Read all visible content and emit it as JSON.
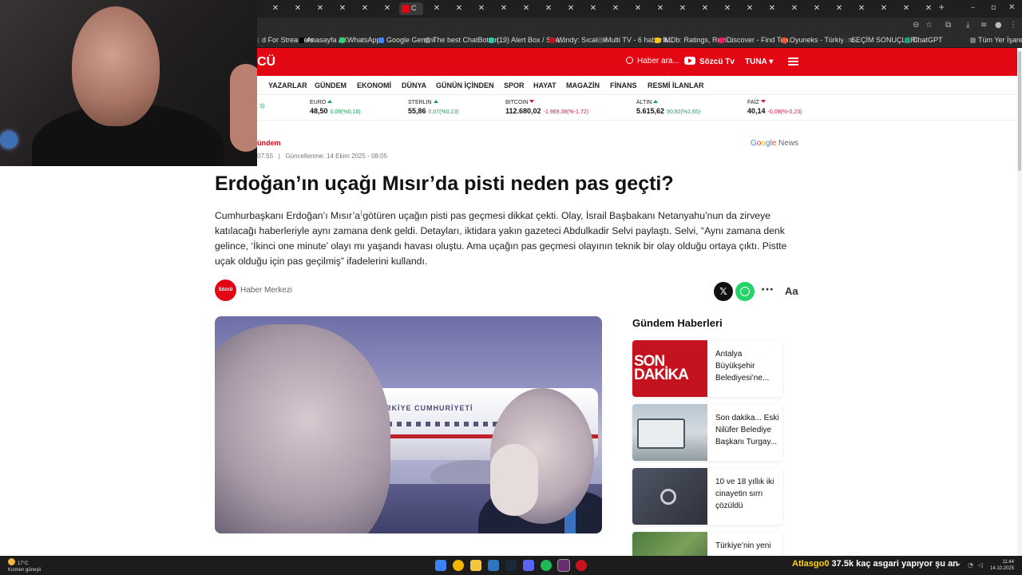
{
  "browser": {
    "active_tab_label": "C",
    "bookmarks": [
      {
        "label": "d For Streamers",
        "color": "#444444"
      },
      {
        "label": "Anasayfa / X",
        "color": "#000000"
      },
      {
        "label": "WhatsApp",
        "color": "#25d366"
      },
      {
        "label": "Google Gemini",
        "color": "#4285f4"
      },
      {
        "label": "The best ChatBot an...",
        "color": "#888888"
      },
      {
        "label": "(19) Alert Box / Stre...",
        "color": "#31c3a2"
      },
      {
        "label": "Windy: Sıcaklık",
        "color": "#c4121f"
      },
      {
        "label": "Multi TV - 6 haber k...",
        "color": "#555555"
      },
      {
        "label": "IMDb: Ratings, Revi...",
        "color": "#f5c518"
      },
      {
        "label": "Discover - Find Top...",
        "color": "#e91e63"
      },
      {
        "label": "Oyuneks - Türkiyeni...",
        "color": "#ff5722"
      },
      {
        "label": "SEÇİM SONUÇLARI...",
        "color": "#333333"
      },
      {
        "label": "ChatGPT",
        "color": "#10a37f"
      },
      {
        "label": "Tüm Yer İşaretleri",
        "color": "#777777"
      }
    ]
  },
  "site": {
    "logo_text": "CÜ",
    "search_label": "Haber ara...",
    "tv_label": "Sözcü Tv",
    "user_label": "TUNA",
    "nav": [
      "YAZARLAR",
      "GÜNDEM",
      "EKONOMİ",
      "DÜNYA",
      "GÜNÜN İÇİNDEN",
      "SPOR",
      "HAYAT",
      "MAGAZİN",
      "FİNANS",
      "RESMİ İLANLAR"
    ],
    "markets": [
      {
        "name": "",
        "value": "",
        "change": "3)",
        "direction": "none"
      },
      {
        "name": "EURO",
        "value": "48,50",
        "change": "0,09(%0,18)",
        "direction": "up"
      },
      {
        "name": "STERLIN",
        "value": "55,86",
        "change": "0,07(%0,13)",
        "direction": "up"
      },
      {
        "name": "BITCOIN",
        "value": "112.680,02",
        "change": "-1.969,38(%-1,72)",
        "direction": "down"
      },
      {
        "name": "ALTIN",
        "value": "5.615,62",
        "change": "90,92(%1,65)",
        "direction": "up"
      },
      {
        "name": "FAİZ",
        "value": "40,14",
        "change": "-0,09(%-0,23)",
        "direction": "down"
      }
    ]
  },
  "article": {
    "category": "ündem",
    "published_partial": "07:55",
    "updated": "Güncellenme: 14 Ekim 2025 - 08:05",
    "google_news_label": "News",
    "headline": "Erdoğan’ın uçağı Mısır’da pisti neden pas geçti?",
    "summary": "Cumhurbaşkanı Erdoğan’ı Mısır’a götüren uçağın pisti pas geçmesi dikkat çekti. Olay, İsrail Başbakanı Netanyahu’nun da zirveye katılacağı haberleriyle aynı zamana denk geldi. Detayları, iktidara yakın gazeteci Abdulkadir Selvi paylaştı. Selvi, “Aynı zamana denk gelince, ‘İkinci one minute’ olayı mı yaşandı havası oluştu. Ama uçağın pas geçmesi olayının teknik bir olay olduğu ortaya çıktı. Pistte uçak olduğu için pas geçilmiş” ifadelerini kullandı.",
    "author_badge": "Sözcü",
    "author": "Haber Merkezi",
    "plane_text": "TÜRKİYE CUMHURİYETİ",
    "font_size_label": "Aa"
  },
  "sidebar": {
    "title": "Gündem Haberleri",
    "son_dakika_line1": "SON",
    "son_dakika_line2": "DAKİKA",
    "items": [
      {
        "title": "Antalya Büyükşehir Belediyesi’ne..."
      },
      {
        "title": "Son dakika... Eski Nilüfer Belediye Başkanı Turgay..."
      },
      {
        "title": "10 ve 18 yıllık iki cinayetin sırrı çözüldü"
      },
      {
        "title": "Türkiye’nin yeni"
      }
    ]
  },
  "taskbar": {
    "weather_temp": "17°C",
    "weather_desc": "Kısmen güneşli",
    "stream_user": "Atlasgo0",
    "stream_msg": "37.5k kaç asgari yapıyor şu an",
    "time": "11:44",
    "date": "14.10.2025"
  },
  "colors": {
    "brand_red": "#e30613",
    "up_green": "#1aa05a",
    "down_red": "#d4183d"
  }
}
